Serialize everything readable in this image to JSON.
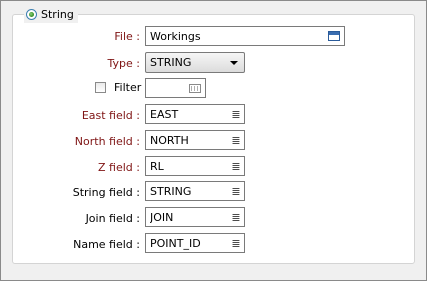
{
  "group": {
    "title": "String",
    "selected": true
  },
  "fields": {
    "file": {
      "label": "File :",
      "value": "Workings",
      "icon": "browse-icon"
    },
    "type": {
      "label": "Type :",
      "value": "STRING"
    },
    "filter": {
      "label": "Filter",
      "checked": false,
      "value": ""
    },
    "east": {
      "label": "East field :",
      "value": "EAST"
    },
    "north": {
      "label": "North field :",
      "value": "NORTH"
    },
    "z": {
      "label": "Z field :",
      "value": "RL"
    },
    "string": {
      "label": "String field :",
      "value": "STRING"
    },
    "join": {
      "label": "Join field :",
      "value": "JOIN"
    },
    "name": {
      "label": "Name field :",
      "value": "POINT_ID"
    }
  },
  "list_icon_glyph": "≣",
  "colors": {
    "required_label": "#7f1414",
    "background": "#f0f0f0",
    "panel": "#ffffff"
  }
}
